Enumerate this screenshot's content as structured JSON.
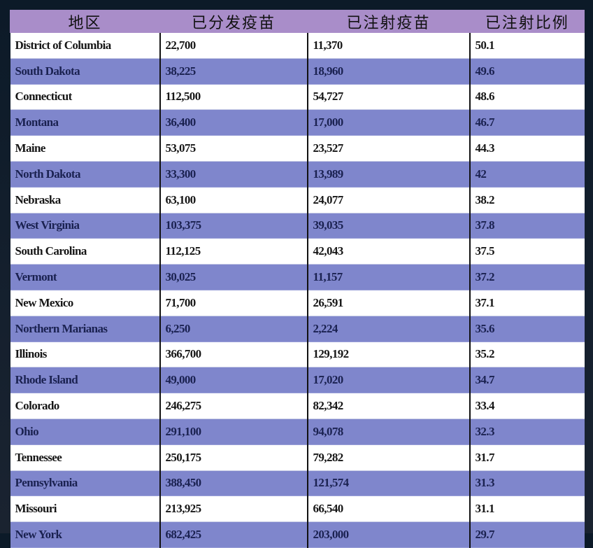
{
  "colors": {
    "header_bg": "#a98dc9",
    "row_alt_bg": "#7f86cc",
    "row_bg": "#ffffff",
    "page_bg": "#0c1a28"
  },
  "table": {
    "headers": [
      "地区",
      "已分发疫苗",
      "已注射疫苗",
      "已注射比例"
    ],
    "rows": [
      [
        "District of Columbia",
        "22,700",
        "11,370",
        "50.1"
      ],
      [
        "South Dakota",
        "38,225",
        "18,960",
        "49.6"
      ],
      [
        "Connecticut",
        "112,500",
        "54,727",
        "48.6"
      ],
      [
        "Montana",
        "36,400",
        "17,000",
        "46.7"
      ],
      [
        "Maine",
        "53,075",
        "23,527",
        "44.3"
      ],
      [
        "North Dakota",
        "33,300",
        "13,989",
        "42"
      ],
      [
        "Nebraska",
        "63,100",
        "24,077",
        "38.2"
      ],
      [
        "West Virginia",
        "103,375",
        "39,035",
        "37.8"
      ],
      [
        "South Carolina",
        "112,125",
        "42,043",
        "37.5"
      ],
      [
        "Vermont",
        "30,025",
        "11,157",
        "37.2"
      ],
      [
        "New Mexico",
        "71,700",
        "26,591",
        "37.1"
      ],
      [
        "Northern Marianas",
        "6,250",
        "2,224",
        "35.6"
      ],
      [
        "Illinois",
        "366,700",
        "129,192",
        "35.2"
      ],
      [
        "Rhode Island",
        "49,000",
        "17,020",
        "34.7"
      ],
      [
        "Colorado",
        "246,275",
        "82,342",
        "33.4"
      ],
      [
        "Ohio",
        "291,100",
        "94,078",
        "32.3"
      ],
      [
        "Tennessee",
        "250,175",
        "79,282",
        "31.7"
      ],
      [
        "Pennsylvania",
        "388,450",
        "121,574",
        "31.3"
      ],
      [
        "Missouri",
        "213,925",
        "66,540",
        "31.1"
      ],
      [
        "New York",
        "682,425",
        "203,000",
        "29.7"
      ]
    ]
  }
}
